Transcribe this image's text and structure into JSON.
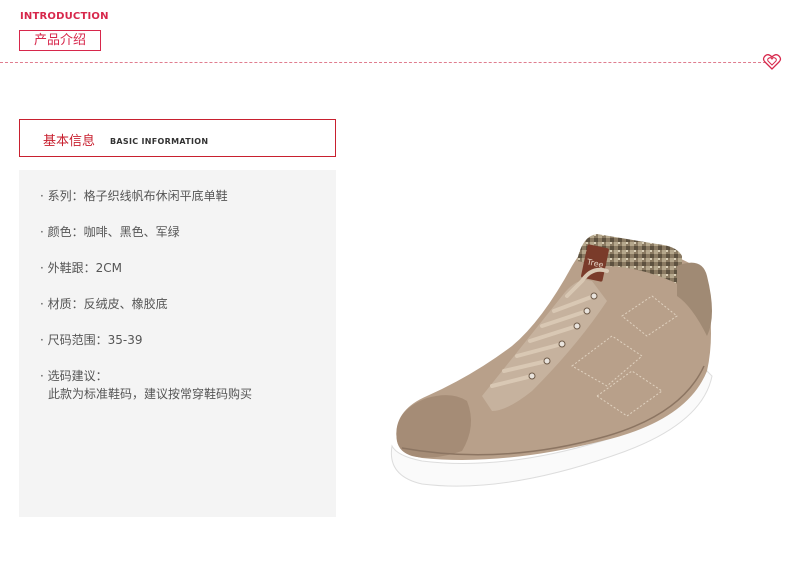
{
  "header": {
    "intro_en": "INTRODUCTION",
    "intro_cn": "产品介绍",
    "accent_color": "#d7274b"
  },
  "basic_info": {
    "title_cn": "基本信息",
    "title_en": "BASIC INFORMATION",
    "items": [
      "· 系列：格子织线帆布休闲平底单鞋",
      "· 颜色：咖啡、黑色、军绿",
      "· 外鞋跟：2CM",
      "· 材质：反绒皮、橡胶底",
      "· 尺码范围：35-39",
      "· 选码建议："
    ],
    "advice": "此款为标准鞋码，建议按常穿鞋码购买"
  },
  "product_image": {
    "description_icon": "shoe-image",
    "brand_tag": "Tree"
  }
}
